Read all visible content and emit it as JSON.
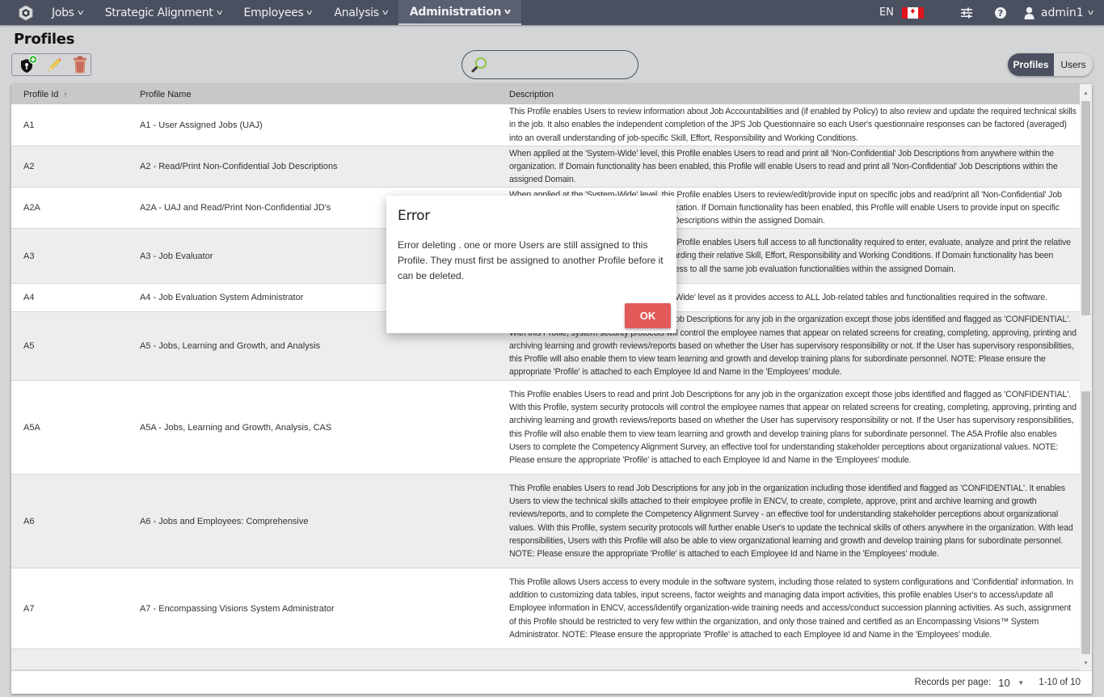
{
  "nav": {
    "items": [
      {
        "label": "Jobs",
        "active": false
      },
      {
        "label": "Strategic Alignment",
        "active": false
      },
      {
        "label": "Employees",
        "active": false
      },
      {
        "label": "Analysis",
        "active": false
      },
      {
        "label": "Administration",
        "active": true
      }
    ],
    "language": "EN",
    "flag": "canada-flag",
    "username": "admin1",
    "accent": "#4a5060"
  },
  "page": {
    "title": "Profiles"
  },
  "toolbar": {
    "add_profile": "add-profile-icon",
    "edit": "edit-icon",
    "delete": "delete-icon"
  },
  "search": {
    "value": "",
    "placeholder": ""
  },
  "view_toggle": {
    "options": [
      "Profiles",
      "Users"
    ],
    "selected": "Profiles"
  },
  "table": {
    "columns": [
      "Profile Id",
      "Profile Name",
      "Description"
    ],
    "sort": {
      "column": "Profile Id",
      "direction": "ascending"
    },
    "rows": [
      {
        "id": "A1",
        "name": "A1 - User Assigned Jobs (UAJ)",
        "description": "This Profile enables Users to review information about Job Accountabilities and (if enabled by Policy) to also review and update the required technical skills in the job. It also enables the independent completion of the JPS Job Questionnaire so each User's questionnaire responses can be factored (averaged) into an overall understanding of job-specific Skill, Effort, Responsibility and Working Conditions."
      },
      {
        "id": "A2",
        "name": "A2 - Read/Print Non-Confidential Job Descriptions",
        "description": "When applied at the 'System-Wide' level, this Profile enables Users to read and print all 'Non-Confidential' Job Descriptions from anywhere within the organization. If Domain functionality has been enabled, this Profile will enable Users to read and print all 'Non-Confidential' Job Descriptions within the assigned Domain."
      },
      {
        "id": "A2A",
        "name": "A2A - UAJ and Read/Print Non-Confidential JD's",
        "description": "When applied at the 'System-Wide' level, this Profile enables Users to review/edit/provide input on specific jobs and read/print all 'Non-Confidential' Job Descriptions from anywhere within the organization. If Domain functionality has been enabled, this Profile will enable Users to provide input on specific jobs and read/print all 'Non-Confidential' Job Descriptions within the assigned Domain."
      },
      {
        "id": "A3",
        "name": "A3 - Job Evaluator",
        "description": "When applied at the 'System-Wide' level, this Profile enables Users full access to all functionality required to enter, evaluate, analyze and print the relative value of every job within the organization regarding their relative Skill, Effort, Responsibility and Working Conditions. If Domain functionality has been enabled, this Profile will enable Users full access to all the same job evaluation functionalities within the assigned Domain."
      },
      {
        "id": "A4",
        "name": "A4 - Job Evaluation System Administrator",
        "description": "This Profile should be applied at the 'System-Wide' level as it provides access to ALL Job-related tables and functionalities required in the software."
      },
      {
        "id": "A5",
        "name": "A5 - Jobs, Learning and Growth, and Analysis",
        "description": "This Profile enables Users to read and print Job Descriptions for any job in the organization except those jobs identified and flagged as 'CONFIDENTIAL'. With this Profile, system security protocols will control the employee names that appear on related screens for creating, completing, approving, printing and archiving learning and growth reviews/reports based on whether the User has supervisory responsibility or not. If the User has supervisory responsibilities, this Profile will also enable them to view team learning and growth and develop training plans for subordinate personnel. NOTE: Please ensure the appropriate 'Profile' is attached to each Employee Id and Name in the 'Employees' module."
      },
      {
        "id": "A5A",
        "name": "A5A - Jobs, Learning and Growth, Analysis, CAS",
        "description": "This Profile enables Users to read and print Job Descriptions for any job in the organization except those jobs identified and flagged as 'CONFIDENTIAL'. With this Profile, system security protocols will control the employee names that appear on related screens for creating, completing, approving, printing and archiving learning and growth reviews/reports based on whether the User has supervisory responsibility or not. If the User has supervisory responsibilities, this Profile will also enable them to view team learning and growth and develop training plans for subordinate personnel. The A5A Profile also enables Users to complete the Competency Alignment Survey, an effective tool for understanding stakeholder perceptions about organizational values. NOTE: Please ensure the appropriate 'Profile' is attached to each Employee Id and Name in the 'Employees' module."
      },
      {
        "id": "A6",
        "name": "A6 - Jobs and Employees: Comprehensive",
        "description": "This Profile enables Users to read Job Descriptions for any job in the organization including those identified and flagged as 'CONFIDENTIAL'. It enables Users to view the technical skills attached to their employee profile in ENCV, to create, complete, approve, print and archive learning and growth reviews/reports, and to complete the Competency Alignment Survey - an effective tool for understanding stakeholder perceptions about organizational values. With this Profile, system security protocols will further enable User's to update the technical skills of others anywhere in the organization. With lead responsibilities, Users with this Profile will also be able to view organizational learning and growth and develop training plans for subordinate personnel. NOTE: Please ensure the appropriate 'Profile' is attached to each Employee Id and Name in the 'Employees' module."
      },
      {
        "id": "A7",
        "name": "A7 - Encompassing Visions System Administrator",
        "description": "This Profile allows Users access to every module in the software system, including those related to system configurations and 'Confidential' information. In addition to customizing data tables, input screens, factor weights and managing data import activities, this profile enables User's to access/update all Employee information in ENCV, access/identify organization-wide training needs and access/conduct succession planning activities. As such, assignment of this Profile should be restricted to very few within the organization, and only those trained and certified as an Encompassing Visions™ System Administrator. NOTE: Please ensure the appropriate 'Profile' is attached to each Employee Id and Name in the 'Employees' module."
      }
    ]
  },
  "pagination": {
    "records_per_page_label": "Records per page:",
    "records_per_page": "10",
    "range": "1-10 of 10"
  },
  "dialog": {
    "title": "Error",
    "message": "Error deleting . one or more Users are still assigned to this Profile. They must first be assigned to another Profile before it can be deleted.",
    "ok_label": "OK",
    "ok_color": "#e25a5a"
  }
}
